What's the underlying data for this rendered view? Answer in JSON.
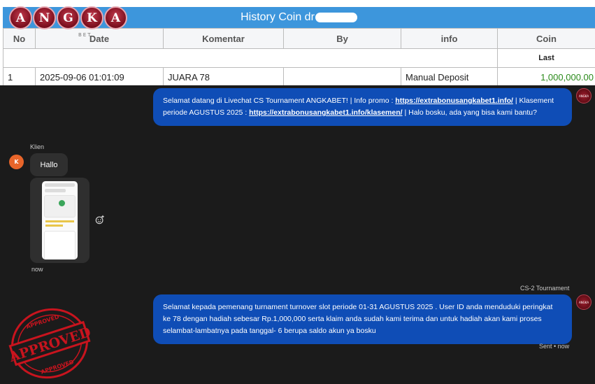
{
  "history": {
    "title": "History Coin dr",
    "columns": [
      "No",
      "Date",
      "Komentar",
      "By",
      "info",
      "Coin"
    ],
    "subheader_last": "Last",
    "rows": [
      {
        "no": "1",
        "date": "2025-09-06 01:01:09",
        "komentar": "JUARA 78",
        "by": "",
        "info": "Manual Deposit",
        "coin": "1,000,000.00"
      }
    ]
  },
  "logo": {
    "letters": [
      "A",
      "N",
      "G",
      "K",
      "A"
    ],
    "subtext": "BET"
  },
  "chat": {
    "welcome": {
      "text1": "Selamat datang di Livechat CS Tournament ANGKABET! | Info promo : ",
      "link1": "https://extrabonusangkabet1.info/",
      "text2": " | Klasement periode AGUSTUS 2025 : ",
      "link2": "https://extrabonusangkabet1.info/klasemen/",
      "text3": " | Halo bosku, ada yang bisa kami bantu?"
    },
    "client": {
      "sender": "Klien",
      "avatar_initial": "K",
      "message": "Hallo",
      "time": "now"
    },
    "agent": {
      "sender": "CS-2 Tournament",
      "message": "Selamat kepada pemenang turnament turnover slot periode 01-31 AGUSTUS 2025 . User ID anda menduduki peringkat ke 78 dengan hadiah sebesar Rp.1,000,000 serta klaim anda sudah kami terima dan untuk hadiah akan kami proses selambat-lambatnya pada tanggal- 6 berupa saldo akun ya bosku",
      "status": "Sent • now"
    }
  },
  "stamp": {
    "top": "APPROVED",
    "middle": "APPROVED",
    "bottom": "APPROVED"
  },
  "colors": {
    "accent_blue": "#0f4db6",
    "title_blue": "#3d96dc",
    "coin_green": "#2a8a1a",
    "stamp_red": "#c8141e"
  }
}
